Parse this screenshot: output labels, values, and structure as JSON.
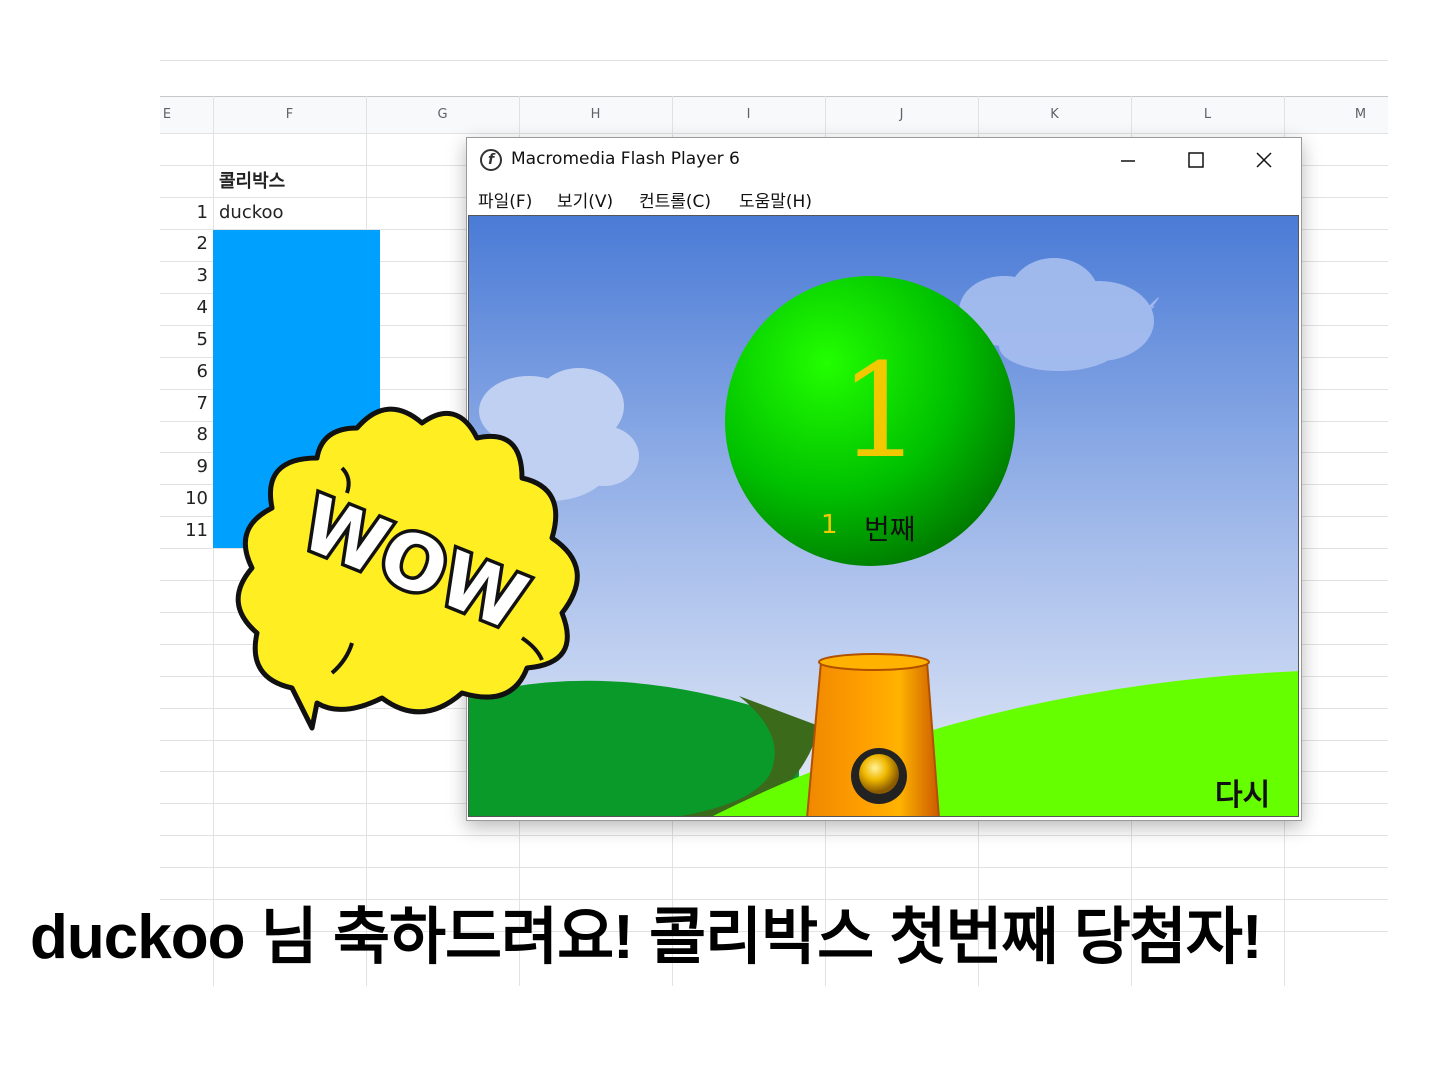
{
  "sheet": {
    "columns": [
      "E",
      "F",
      "G",
      "H",
      "I",
      "J",
      "K",
      "L",
      "M"
    ],
    "header_cell": "콜리박스",
    "first_value": "duckoo",
    "rows": [
      "1",
      "2",
      "3",
      "4",
      "5",
      "6",
      "7",
      "8",
      "9",
      "10",
      "11"
    ]
  },
  "window": {
    "title": "Macromedia Flash Player 6",
    "menus": [
      "파일(F)",
      "보기(V)",
      "컨트롤(C)",
      "도움말(H)"
    ]
  },
  "game": {
    "big_number": "1",
    "count": "1",
    "count_label": "번째",
    "retry_label": "다시"
  },
  "sticker": {
    "text": "WOW"
  },
  "headline": "duckoo 님 축하드려요! 콜리박스 첫번째 당첨자!",
  "colors": {
    "selection": "#00a0ff",
    "sky_top": "#4a7bd6",
    "ball": "#00c800",
    "number": "#f2c800",
    "grass": "#66ff00",
    "cannon": "#ff9900",
    "wow_fill": "#ffee22"
  }
}
